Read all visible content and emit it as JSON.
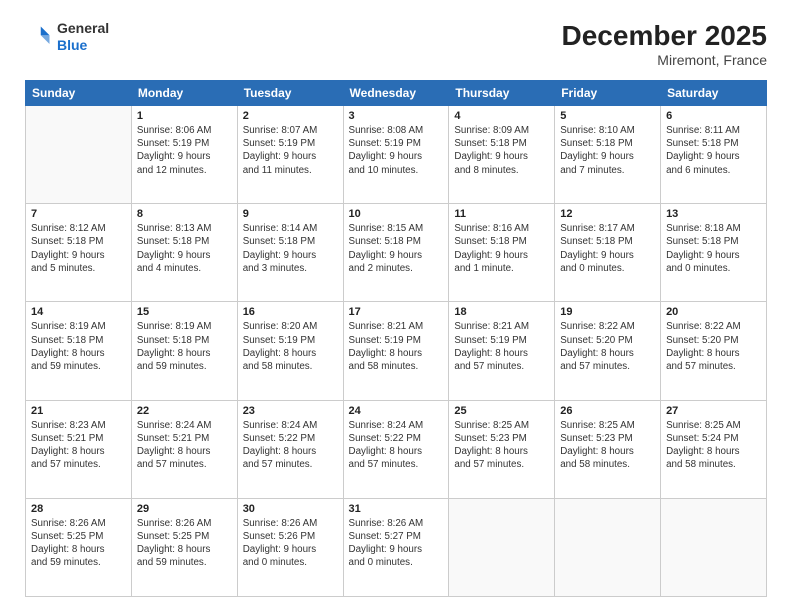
{
  "header": {
    "logo_line1": "General",
    "logo_line2": "Blue",
    "month_year": "December 2025",
    "location": "Miremont, France"
  },
  "days_of_week": [
    "Sunday",
    "Monday",
    "Tuesday",
    "Wednesday",
    "Thursday",
    "Friday",
    "Saturday"
  ],
  "weeks": [
    [
      {
        "day": "",
        "info": ""
      },
      {
        "day": "1",
        "info": "Sunrise: 8:06 AM\nSunset: 5:19 PM\nDaylight: 9 hours\nand 12 minutes."
      },
      {
        "day": "2",
        "info": "Sunrise: 8:07 AM\nSunset: 5:19 PM\nDaylight: 9 hours\nand 11 minutes."
      },
      {
        "day": "3",
        "info": "Sunrise: 8:08 AM\nSunset: 5:19 PM\nDaylight: 9 hours\nand 10 minutes."
      },
      {
        "day": "4",
        "info": "Sunrise: 8:09 AM\nSunset: 5:18 PM\nDaylight: 9 hours\nand 8 minutes."
      },
      {
        "day": "5",
        "info": "Sunrise: 8:10 AM\nSunset: 5:18 PM\nDaylight: 9 hours\nand 7 minutes."
      },
      {
        "day": "6",
        "info": "Sunrise: 8:11 AM\nSunset: 5:18 PM\nDaylight: 9 hours\nand 6 minutes."
      }
    ],
    [
      {
        "day": "7",
        "info": "Sunrise: 8:12 AM\nSunset: 5:18 PM\nDaylight: 9 hours\nand 5 minutes."
      },
      {
        "day": "8",
        "info": "Sunrise: 8:13 AM\nSunset: 5:18 PM\nDaylight: 9 hours\nand 4 minutes."
      },
      {
        "day": "9",
        "info": "Sunrise: 8:14 AM\nSunset: 5:18 PM\nDaylight: 9 hours\nand 3 minutes."
      },
      {
        "day": "10",
        "info": "Sunrise: 8:15 AM\nSunset: 5:18 PM\nDaylight: 9 hours\nand 2 minutes."
      },
      {
        "day": "11",
        "info": "Sunrise: 8:16 AM\nSunset: 5:18 PM\nDaylight: 9 hours\nand 1 minute."
      },
      {
        "day": "12",
        "info": "Sunrise: 8:17 AM\nSunset: 5:18 PM\nDaylight: 9 hours\nand 0 minutes."
      },
      {
        "day": "13",
        "info": "Sunrise: 8:18 AM\nSunset: 5:18 PM\nDaylight: 9 hours\nand 0 minutes."
      }
    ],
    [
      {
        "day": "14",
        "info": "Sunrise: 8:19 AM\nSunset: 5:18 PM\nDaylight: 8 hours\nand 59 minutes."
      },
      {
        "day": "15",
        "info": "Sunrise: 8:19 AM\nSunset: 5:18 PM\nDaylight: 8 hours\nand 59 minutes."
      },
      {
        "day": "16",
        "info": "Sunrise: 8:20 AM\nSunset: 5:19 PM\nDaylight: 8 hours\nand 58 minutes."
      },
      {
        "day": "17",
        "info": "Sunrise: 8:21 AM\nSunset: 5:19 PM\nDaylight: 8 hours\nand 58 minutes."
      },
      {
        "day": "18",
        "info": "Sunrise: 8:21 AM\nSunset: 5:19 PM\nDaylight: 8 hours\nand 57 minutes."
      },
      {
        "day": "19",
        "info": "Sunrise: 8:22 AM\nSunset: 5:20 PM\nDaylight: 8 hours\nand 57 minutes."
      },
      {
        "day": "20",
        "info": "Sunrise: 8:22 AM\nSunset: 5:20 PM\nDaylight: 8 hours\nand 57 minutes."
      }
    ],
    [
      {
        "day": "21",
        "info": "Sunrise: 8:23 AM\nSunset: 5:21 PM\nDaylight: 8 hours\nand 57 minutes."
      },
      {
        "day": "22",
        "info": "Sunrise: 8:24 AM\nSunset: 5:21 PM\nDaylight: 8 hours\nand 57 minutes."
      },
      {
        "day": "23",
        "info": "Sunrise: 8:24 AM\nSunset: 5:22 PM\nDaylight: 8 hours\nand 57 minutes."
      },
      {
        "day": "24",
        "info": "Sunrise: 8:24 AM\nSunset: 5:22 PM\nDaylight: 8 hours\nand 57 minutes."
      },
      {
        "day": "25",
        "info": "Sunrise: 8:25 AM\nSunset: 5:23 PM\nDaylight: 8 hours\nand 57 minutes."
      },
      {
        "day": "26",
        "info": "Sunrise: 8:25 AM\nSunset: 5:23 PM\nDaylight: 8 hours\nand 58 minutes."
      },
      {
        "day": "27",
        "info": "Sunrise: 8:25 AM\nSunset: 5:24 PM\nDaylight: 8 hours\nand 58 minutes."
      }
    ],
    [
      {
        "day": "28",
        "info": "Sunrise: 8:26 AM\nSunset: 5:25 PM\nDaylight: 8 hours\nand 59 minutes."
      },
      {
        "day": "29",
        "info": "Sunrise: 8:26 AM\nSunset: 5:25 PM\nDaylight: 8 hours\nand 59 minutes."
      },
      {
        "day": "30",
        "info": "Sunrise: 8:26 AM\nSunset: 5:26 PM\nDaylight: 9 hours\nand 0 minutes."
      },
      {
        "day": "31",
        "info": "Sunrise: 8:26 AM\nSunset: 5:27 PM\nDaylight: 9 hours\nand 0 minutes."
      },
      {
        "day": "",
        "info": ""
      },
      {
        "day": "",
        "info": ""
      },
      {
        "day": "",
        "info": ""
      }
    ]
  ]
}
